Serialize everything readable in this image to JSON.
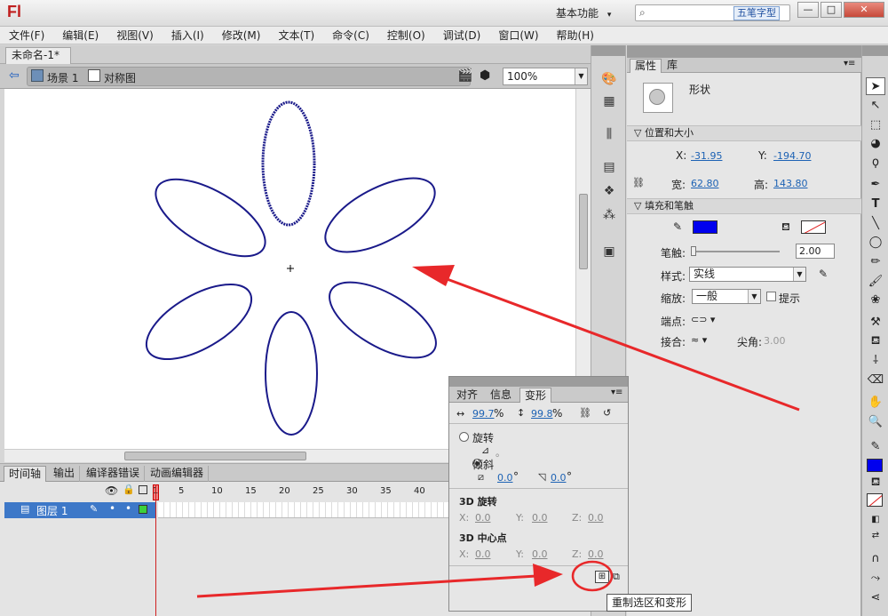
{
  "app": {
    "logo": "Fl",
    "workspace": "基本功能",
    "workspace_arrow": "▾",
    "ime": "五笔字型",
    "search_placeholder": ""
  },
  "window_buttons": {
    "minimize": "—",
    "maximize": "□",
    "close": "✕"
  },
  "menu": [
    "文件(F)",
    "编辑(E)",
    "视图(V)",
    "插入(I)",
    "修改(M)",
    "文本(T)",
    "命令(C)",
    "控制(O)",
    "调试(D)",
    "窗口(W)",
    "帮助(H)"
  ],
  "document": {
    "tab": "未命名-1*",
    "close": "×",
    "scene": "场景 1",
    "symbol": "对称图",
    "zoom": "100%"
  },
  "properties": {
    "tabs": [
      "属性",
      "库"
    ],
    "type": "形状",
    "position_size": {
      "title": "位置和大小",
      "x_label": "X:",
      "x": "-31.95",
      "y_label": "Y:",
      "y": "-194.70",
      "w_label": "宽:",
      "w": "62.80",
      "h_label": "高:",
      "h": "143.80"
    },
    "fill_stroke": {
      "title": "填充和笔触",
      "stroke_color": "#0000ee",
      "stroke_label": "笔触:",
      "stroke_value": "2.00",
      "style_label": "样式:",
      "style_value": "实线",
      "scale_label": "缩放:",
      "scale_value": "一般",
      "hint_label": "提示",
      "cap_label": "端点:",
      "join_label": "接合:",
      "miter_label": "尖角:",
      "miter_value": "3.00"
    }
  },
  "timeline": {
    "tabs": [
      "时间轴",
      "输出",
      "编译器错误",
      "动画编辑器"
    ],
    "frame_numbers": [
      "1",
      "5",
      "10",
      "15",
      "20",
      "25",
      "30",
      "35",
      "40"
    ],
    "layer": "图层 1"
  },
  "transform_panel": {
    "tabs": [
      "对齐",
      "信息",
      "变形"
    ],
    "width_pct": "99.7",
    "height_pct": "99.8",
    "pct": "%",
    "rotate_label": "旋转",
    "rotate_value": "。",
    "skew_label": "倾斜",
    "skew_h": "0.0",
    "skew_v": "0.0",
    "deg": "°",
    "rot3d_label": "3D 旋转",
    "rot3d": {
      "x": "0.0",
      "y": "0.0",
      "z": "0.0"
    },
    "center3d_label": "3D 中心点",
    "center3d": {
      "x": "0.0",
      "y": "0.0",
      "z": "0.0"
    },
    "x_label": "X:",
    "y_label": "Y:",
    "z_label": "Z:"
  },
  "tooltip": "重制选区和变形",
  "colors": {
    "accent": "#1d62b4",
    "selected_layer": "#3d78c8",
    "flower_stroke": "#1a1a8a",
    "annotation": "#e8282a",
    "stroke_swatch": "#0000ee"
  }
}
